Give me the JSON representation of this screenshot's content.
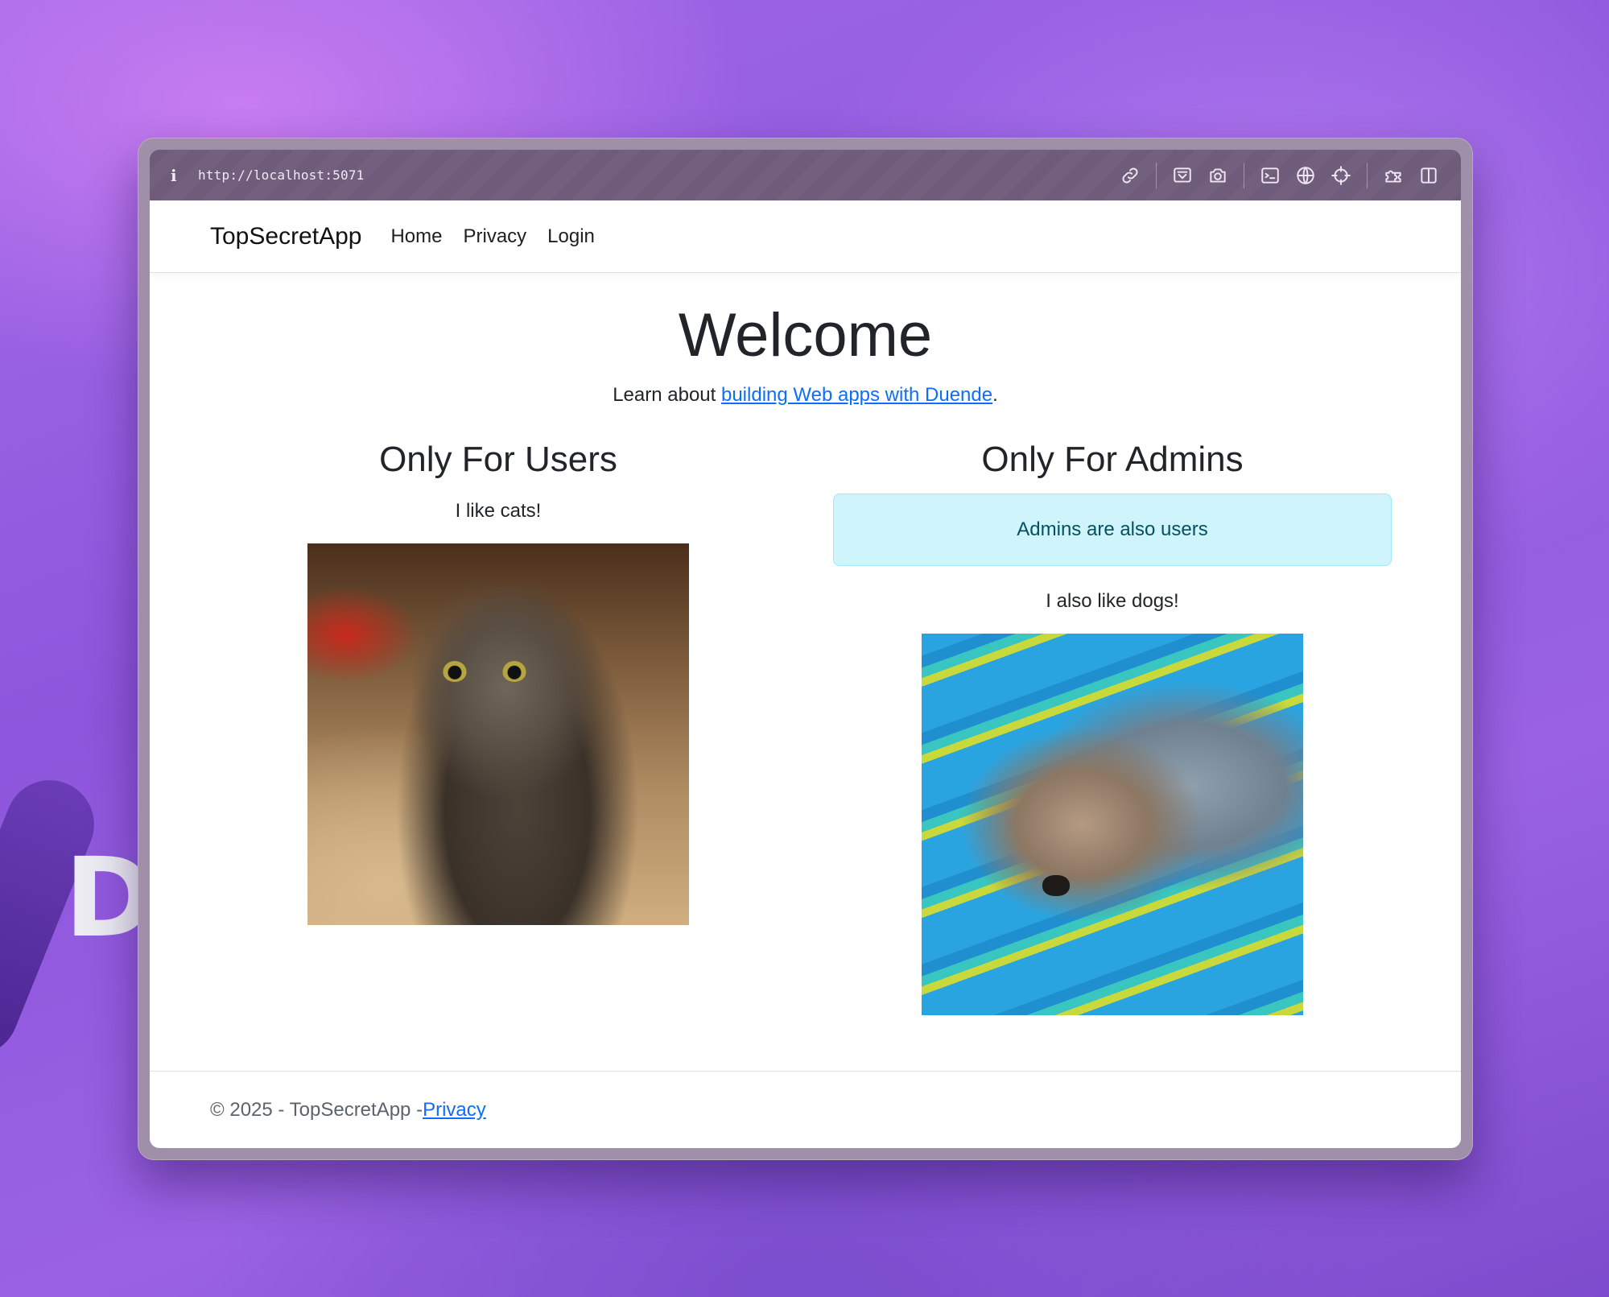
{
  "browser": {
    "info_icon": "info-icon",
    "url": "http://localhost:5071",
    "toolbar_icons": [
      "link-icon",
      "screen-capture-icon",
      "camera-icon",
      "terminal-icon",
      "globe-icon",
      "crosshair-icon",
      "extensions-icon",
      "sidebar-icon"
    ]
  },
  "background": {
    "logo_letter": "D"
  },
  "navbar": {
    "brand": "TopSecretApp",
    "links": [
      "Home",
      "Privacy",
      "Login"
    ]
  },
  "hero": {
    "title": "Welcome",
    "lead_prefix": "Learn about ",
    "lead_link": "building Web apps with Duende",
    "lead_suffix": "."
  },
  "users_section": {
    "heading": "Only For Users",
    "text": "I like cats!",
    "image": "cat-photo"
  },
  "admins_section": {
    "heading": "Only For Admins",
    "alert": "Admins are also users",
    "text": "I also like dogs!",
    "image": "dog-photo"
  },
  "footer": {
    "text": "© 2025 - TopSecretApp - ",
    "link": "Privacy"
  },
  "colors": {
    "link": "#0d6efd",
    "alert_bg": "#cff4fc",
    "alert_text": "#055160",
    "toolbar": "#6f5b7a"
  }
}
